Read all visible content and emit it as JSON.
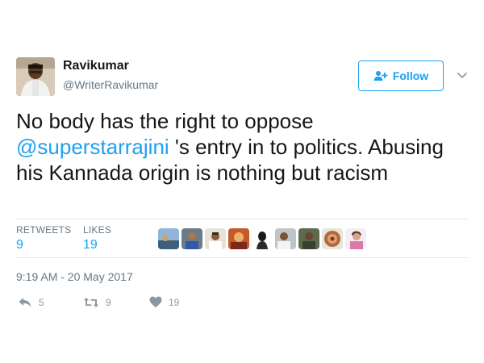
{
  "author": {
    "name": "Ravikumar",
    "handle": "@WriterRavikumar"
  },
  "follow_button": {
    "label": "Follow"
  },
  "tweet": {
    "text_before": "No body has the right to oppose ",
    "mention": "@superstarrajini",
    "text_after": " 's entry in to politics. Abusing his Kannada origin is nothing but racism"
  },
  "stats": {
    "retweets_label": "RETWEETS",
    "retweets_count": "9",
    "likes_label": "LIKES",
    "likes_count": "19"
  },
  "timestamp": "9:19 AM - 20 May 2017",
  "actions": {
    "reply_count": "5",
    "retweet_count": "9",
    "like_count": "19"
  },
  "colors": {
    "accent": "#1da1f2",
    "text": "#14171a",
    "muted": "#657786"
  }
}
